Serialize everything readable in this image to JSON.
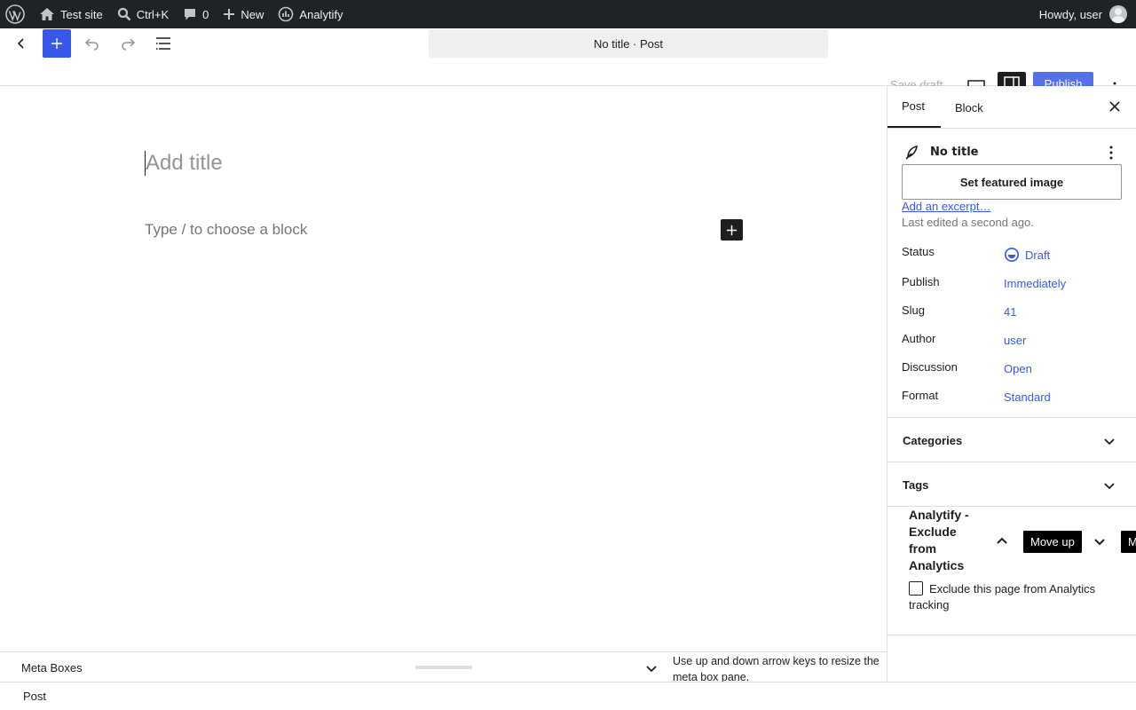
{
  "admin_bar": {
    "site_name": "Test site",
    "search_shortcut": "Ctrl+K",
    "comments_count": "0",
    "new_label": "New",
    "plugin_label": "Analytify",
    "greeting": "Howdy, user"
  },
  "header": {
    "document_title": "No title · Post",
    "save_draft": "Save draft",
    "publish": "Publish"
  },
  "canvas": {
    "title_placeholder": "Add title",
    "block_placeholder": "Type / to choose a block"
  },
  "sidebar": {
    "tabs": [
      "Post",
      "Block"
    ],
    "post_title": "No title",
    "featured_image_button": "Set featured image",
    "excerpt_link": "Add an excerpt…",
    "last_edited": "Last edited a second ago.",
    "rows": [
      {
        "label": "Status",
        "value": "Draft"
      },
      {
        "label": "Publish",
        "value": "Immediately"
      },
      {
        "label": "Slug",
        "value": "41"
      },
      {
        "label": "Author",
        "value": "user"
      },
      {
        "label": "Discussion",
        "value": "Open"
      },
      {
        "label": "Format",
        "value": "Standard"
      }
    ],
    "panels": [
      "Categories",
      "Tags"
    ],
    "analytify": {
      "title": "Analytify - Exclude from Analytics",
      "move_up_tooltip": "Move up",
      "move_down_tooltip": "M",
      "checkbox_label": "Exclude this page from Analytics tracking",
      "checked": false
    }
  },
  "meta_boxes": {
    "label": "Meta Boxes",
    "hint": "Use up and down arrow keys to resize the meta box pane."
  },
  "footer": {
    "breadcrumb": "Post"
  },
  "colors": {
    "admin_bar_bg": "#1d2327",
    "accent": "#3858e9",
    "text": "#1e1e1e",
    "muted": "#757575"
  }
}
